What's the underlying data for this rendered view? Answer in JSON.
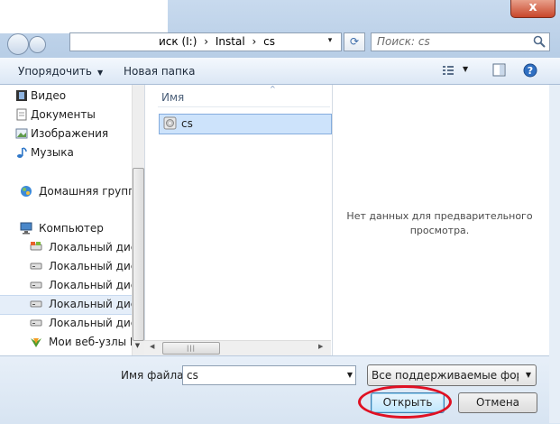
{
  "window": {
    "close_glyph": "x",
    "address": {
      "segments": [
        "иск (I:)",
        "›",
        "Instal",
        "›",
        "cs"
      ],
      "dropdown_glyph": "▾",
      "refresh_glyph": "⟳"
    },
    "search": {
      "placeholder": "Поиск: cs"
    }
  },
  "toolbar": {
    "organize_label": "Упорядочить",
    "new_folder_label": "Новая папка",
    "caret": "▼"
  },
  "nav": {
    "items": [
      {
        "label": "Видео",
        "icon": "video-icon"
      },
      {
        "label": "Документы",
        "icon": "documents-icon"
      },
      {
        "label": "Изображения",
        "icon": "pictures-icon"
      },
      {
        "label": "Музыка",
        "icon": "music-icon"
      },
      {
        "label": "Домашняя группа",
        "icon": "homegroup-icon"
      },
      {
        "label": "Компьютер",
        "icon": "computer-icon"
      },
      {
        "label": "Локальный диск",
        "icon": "drive-icon"
      },
      {
        "label": "Локальный диск",
        "icon": "drive-icon"
      },
      {
        "label": "Локальный диск",
        "icon": "drive-icon"
      },
      {
        "label": "Локальный диск",
        "icon": "drive-icon"
      },
      {
        "label": "Локальный диск",
        "icon": "drive-icon"
      },
      {
        "label": "Мои веб-узлы M",
        "icon": "web-sites-icon"
      }
    ],
    "scroll_down_glyph": "▼"
  },
  "file_list": {
    "column_name": "Имя",
    "sort_glyph": "^",
    "files": [
      {
        "name": "cs",
        "icon": "disc-image-icon"
      }
    ],
    "scroll_left_glyph": "◀",
    "scroll_right_glyph": "▶",
    "thumb_grip": "|||"
  },
  "preview": {
    "line1": "Нет данных для предварительного",
    "line2": "просмотра."
  },
  "bottom": {
    "filename_label": "Имя файла:",
    "filename_value": "cs",
    "filter_value": "Все поддерживаемые формат",
    "dd_glyph": "▼",
    "open_label": "Открыть",
    "cancel_label": "Отмена"
  },
  "colors": {
    "highlight_ellipse": "#e01022",
    "selection": "#cde3fb",
    "chrome": "#c8daee"
  }
}
